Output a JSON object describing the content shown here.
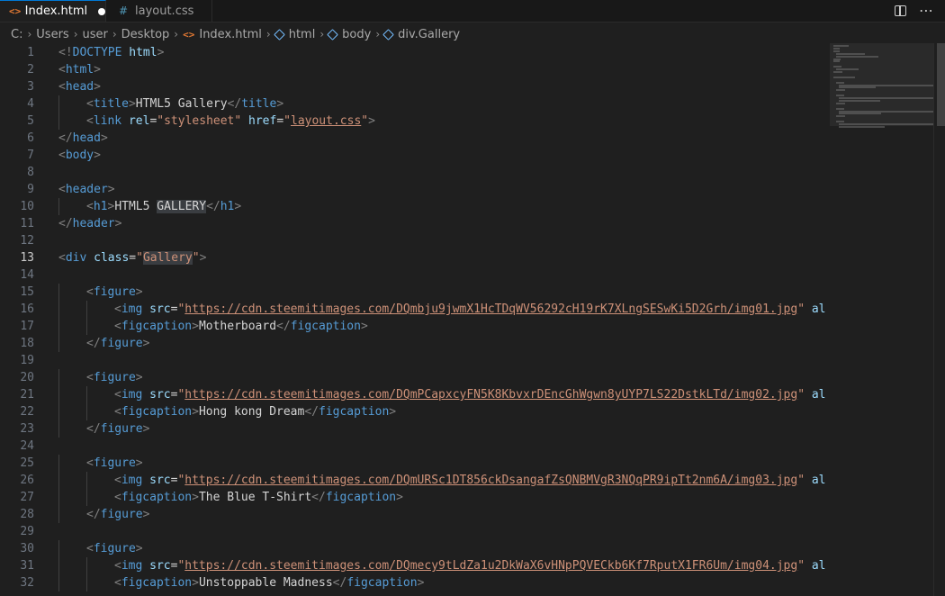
{
  "tabs": [
    {
      "icon": "html-file-icon",
      "glyph": "<>",
      "label": "Index.html",
      "dirty": true
    },
    {
      "icon": "css-file-icon",
      "glyph": "#",
      "label": "layout.css",
      "dirty": false
    }
  ],
  "breadcrumb": [
    "C:",
    "Users",
    "user",
    "Desktop",
    "Index.html",
    "html",
    "body",
    "div.Gallery"
  ],
  "current_line": 13,
  "colors": {
    "tag": "#569cd6",
    "attribute": "#9cdcfe",
    "string": "#ce9178",
    "text": "#d4d4d4",
    "punctuation": "#808080",
    "active_tab_border": "#0078d4"
  },
  "lines": [
    {
      "n": 1,
      "indent": 0,
      "t": [
        [
          "p",
          "<!"
        ],
        [
          "g",
          "DOCTYPE "
        ],
        [
          "a",
          "html"
        ],
        [
          "p",
          ">"
        ]
      ]
    },
    {
      "n": 2,
      "indent": 0,
      "t": [
        [
          "p",
          "<"
        ],
        [
          "g",
          "html"
        ],
        [
          "p",
          ">"
        ]
      ]
    },
    {
      "n": 3,
      "indent": 0,
      "t": [
        [
          "p",
          "<"
        ],
        [
          "g",
          "head"
        ],
        [
          "p",
          ">"
        ]
      ]
    },
    {
      "n": 4,
      "indent": 1,
      "t": [
        [
          "p",
          "<"
        ],
        [
          "g",
          "title"
        ],
        [
          "p",
          ">"
        ],
        [
          "x",
          "HTML5 Gallery"
        ],
        [
          "p",
          "</"
        ],
        [
          "g",
          "title"
        ],
        [
          "p",
          ">"
        ]
      ]
    },
    {
      "n": 5,
      "indent": 1,
      "t": [
        [
          "p",
          "<"
        ],
        [
          "g",
          "link "
        ],
        [
          "a",
          "rel"
        ],
        [
          "x",
          "="
        ],
        [
          "s",
          "\"stylesheet\""
        ],
        [
          "x",
          " "
        ],
        [
          "a",
          "href"
        ],
        [
          "x",
          "="
        ],
        [
          "s",
          "\""
        ],
        [
          "u",
          "layout.css"
        ],
        [
          "s",
          "\""
        ],
        [
          "p",
          ">"
        ]
      ]
    },
    {
      "n": 6,
      "indent": 0,
      "t": [
        [
          "p",
          "</"
        ],
        [
          "g",
          "head"
        ],
        [
          "p",
          ">"
        ]
      ]
    },
    {
      "n": 7,
      "indent": 0,
      "t": [
        [
          "p",
          "<"
        ],
        [
          "g",
          "body"
        ],
        [
          "p",
          ">"
        ]
      ]
    },
    {
      "n": 8,
      "indent": 0,
      "t": []
    },
    {
      "n": 9,
      "indent": 0,
      "t": [
        [
          "p",
          "<"
        ],
        [
          "g",
          "header"
        ],
        [
          "p",
          ">"
        ]
      ]
    },
    {
      "n": 10,
      "indent": 1,
      "t": [
        [
          "p",
          "<"
        ],
        [
          "g",
          "h1"
        ],
        [
          "p",
          ">"
        ],
        [
          "x",
          "HTML5 "
        ],
        [
          "h",
          "GALLERY"
        ],
        [
          "p",
          "</"
        ],
        [
          "g",
          "h1"
        ],
        [
          "p",
          ">"
        ]
      ]
    },
    {
      "n": 11,
      "indent": 0,
      "t": [
        [
          "p",
          "</"
        ],
        [
          "g",
          "header"
        ],
        [
          "p",
          ">"
        ]
      ]
    },
    {
      "n": 12,
      "indent": 0,
      "t": []
    },
    {
      "n": 13,
      "indent": 0,
      "t": [
        [
          "p",
          "<"
        ],
        [
          "g",
          "div "
        ],
        [
          "a",
          "class"
        ],
        [
          "x",
          "="
        ],
        [
          "s",
          "\""
        ],
        [
          "hs",
          "Gallery"
        ],
        [
          "s",
          "\""
        ],
        [
          "p",
          ">"
        ]
      ]
    },
    {
      "n": 14,
      "indent": 0,
      "t": []
    },
    {
      "n": 15,
      "indent": 1,
      "t": [
        [
          "p",
          "<"
        ],
        [
          "g",
          "figure"
        ],
        [
          "p",
          ">"
        ]
      ]
    },
    {
      "n": 16,
      "indent": 2,
      "t": [
        [
          "p",
          "<"
        ],
        [
          "g",
          "img "
        ],
        [
          "a",
          "src"
        ],
        [
          "x",
          "="
        ],
        [
          "s",
          "\""
        ],
        [
          "u",
          "https://cdn.steemitimages.com/DQmbju9jwmX1HcTDqWV56292cH19rK7XLngSESwKi5D2Grh/img01.jpg"
        ],
        [
          "s",
          "\""
        ],
        [
          "x",
          " "
        ],
        [
          "a",
          "alt"
        ],
        [
          "x",
          "="
        ]
      ]
    },
    {
      "n": 17,
      "indent": 2,
      "t": [
        [
          "p",
          "<"
        ],
        [
          "g",
          "figcaption"
        ],
        [
          "p",
          ">"
        ],
        [
          "x",
          "Motherboard"
        ],
        [
          "p",
          "</"
        ],
        [
          "g",
          "figcaption"
        ],
        [
          "p",
          ">"
        ]
      ]
    },
    {
      "n": 18,
      "indent": 1,
      "t": [
        [
          "p",
          "</"
        ],
        [
          "g",
          "figure"
        ],
        [
          "p",
          ">"
        ]
      ]
    },
    {
      "n": 19,
      "indent": 0,
      "t": []
    },
    {
      "n": 20,
      "indent": 1,
      "t": [
        [
          "p",
          "<"
        ],
        [
          "g",
          "figure"
        ],
        [
          "p",
          ">"
        ]
      ]
    },
    {
      "n": 21,
      "indent": 2,
      "t": [
        [
          "p",
          "<"
        ],
        [
          "g",
          "img "
        ],
        [
          "a",
          "src"
        ],
        [
          "x",
          "="
        ],
        [
          "s",
          "\""
        ],
        [
          "u",
          "https://cdn.steemitimages.com/DQmPCapxcyFN5K8KbvxrDEncGhWgwn8yUYP7LS22DstkLTd/img02.jpg"
        ],
        [
          "s",
          "\""
        ],
        [
          "x",
          " "
        ],
        [
          "a",
          "alt"
        ],
        [
          "x",
          "="
        ]
      ]
    },
    {
      "n": 22,
      "indent": 2,
      "t": [
        [
          "p",
          "<"
        ],
        [
          "g",
          "figcaption"
        ],
        [
          "p",
          ">"
        ],
        [
          "x",
          "Hong kong Dream"
        ],
        [
          "p",
          "</"
        ],
        [
          "g",
          "figcaption"
        ],
        [
          "p",
          ">"
        ]
      ]
    },
    {
      "n": 23,
      "indent": 1,
      "t": [
        [
          "p",
          "</"
        ],
        [
          "g",
          "figure"
        ],
        [
          "p",
          ">"
        ]
      ]
    },
    {
      "n": 24,
      "indent": 0,
      "t": []
    },
    {
      "n": 25,
      "indent": 1,
      "t": [
        [
          "p",
          "<"
        ],
        [
          "g",
          "figure"
        ],
        [
          "p",
          ">"
        ]
      ]
    },
    {
      "n": 26,
      "indent": 2,
      "t": [
        [
          "p",
          "<"
        ],
        [
          "g",
          "img "
        ],
        [
          "a",
          "src"
        ],
        [
          "x",
          "="
        ],
        [
          "s",
          "\""
        ],
        [
          "u",
          "https://cdn.steemitimages.com/DQmURSc1DT856ckDsangafZsQNBMVgR3NQqPR9ipTt2nm6A/img03.jpg"
        ],
        [
          "s",
          "\""
        ],
        [
          "x",
          " "
        ],
        [
          "a",
          "alt"
        ],
        [
          "x",
          "="
        ]
      ]
    },
    {
      "n": 27,
      "indent": 2,
      "t": [
        [
          "p",
          "<"
        ],
        [
          "g",
          "figcaption"
        ],
        [
          "p",
          ">"
        ],
        [
          "x",
          "The Blue T-Shirt"
        ],
        [
          "p",
          "</"
        ],
        [
          "g",
          "figcaption"
        ],
        [
          "p",
          ">"
        ]
      ]
    },
    {
      "n": 28,
      "indent": 1,
      "t": [
        [
          "p",
          "</"
        ],
        [
          "g",
          "figure"
        ],
        [
          "p",
          ">"
        ]
      ]
    },
    {
      "n": 29,
      "indent": 0,
      "t": []
    },
    {
      "n": 30,
      "indent": 1,
      "t": [
        [
          "p",
          "<"
        ],
        [
          "g",
          "figure"
        ],
        [
          "p",
          ">"
        ]
      ]
    },
    {
      "n": 31,
      "indent": 2,
      "t": [
        [
          "p",
          "<"
        ],
        [
          "g",
          "img "
        ],
        [
          "a",
          "src"
        ],
        [
          "x",
          "="
        ],
        [
          "s",
          "\""
        ],
        [
          "u",
          "https://cdn.steemitimages.com/DQmecy9tLdZa1u2DkWaX6vHNpPQVECkb6Kf7RputX1FR6Um/img04.jpg"
        ],
        [
          "s",
          "\""
        ],
        [
          "x",
          " "
        ],
        [
          "a",
          "alt"
        ],
        [
          "x",
          "="
        ]
      ]
    },
    {
      "n": 32,
      "indent": 2,
      "t": [
        [
          "p",
          "<"
        ],
        [
          "g",
          "figcaption"
        ],
        [
          "p",
          ">"
        ],
        [
          "x",
          "Unstoppable Madness"
        ],
        [
          "p",
          "</"
        ],
        [
          "g",
          "figcaption"
        ],
        [
          "p",
          ">"
        ]
      ]
    }
  ]
}
